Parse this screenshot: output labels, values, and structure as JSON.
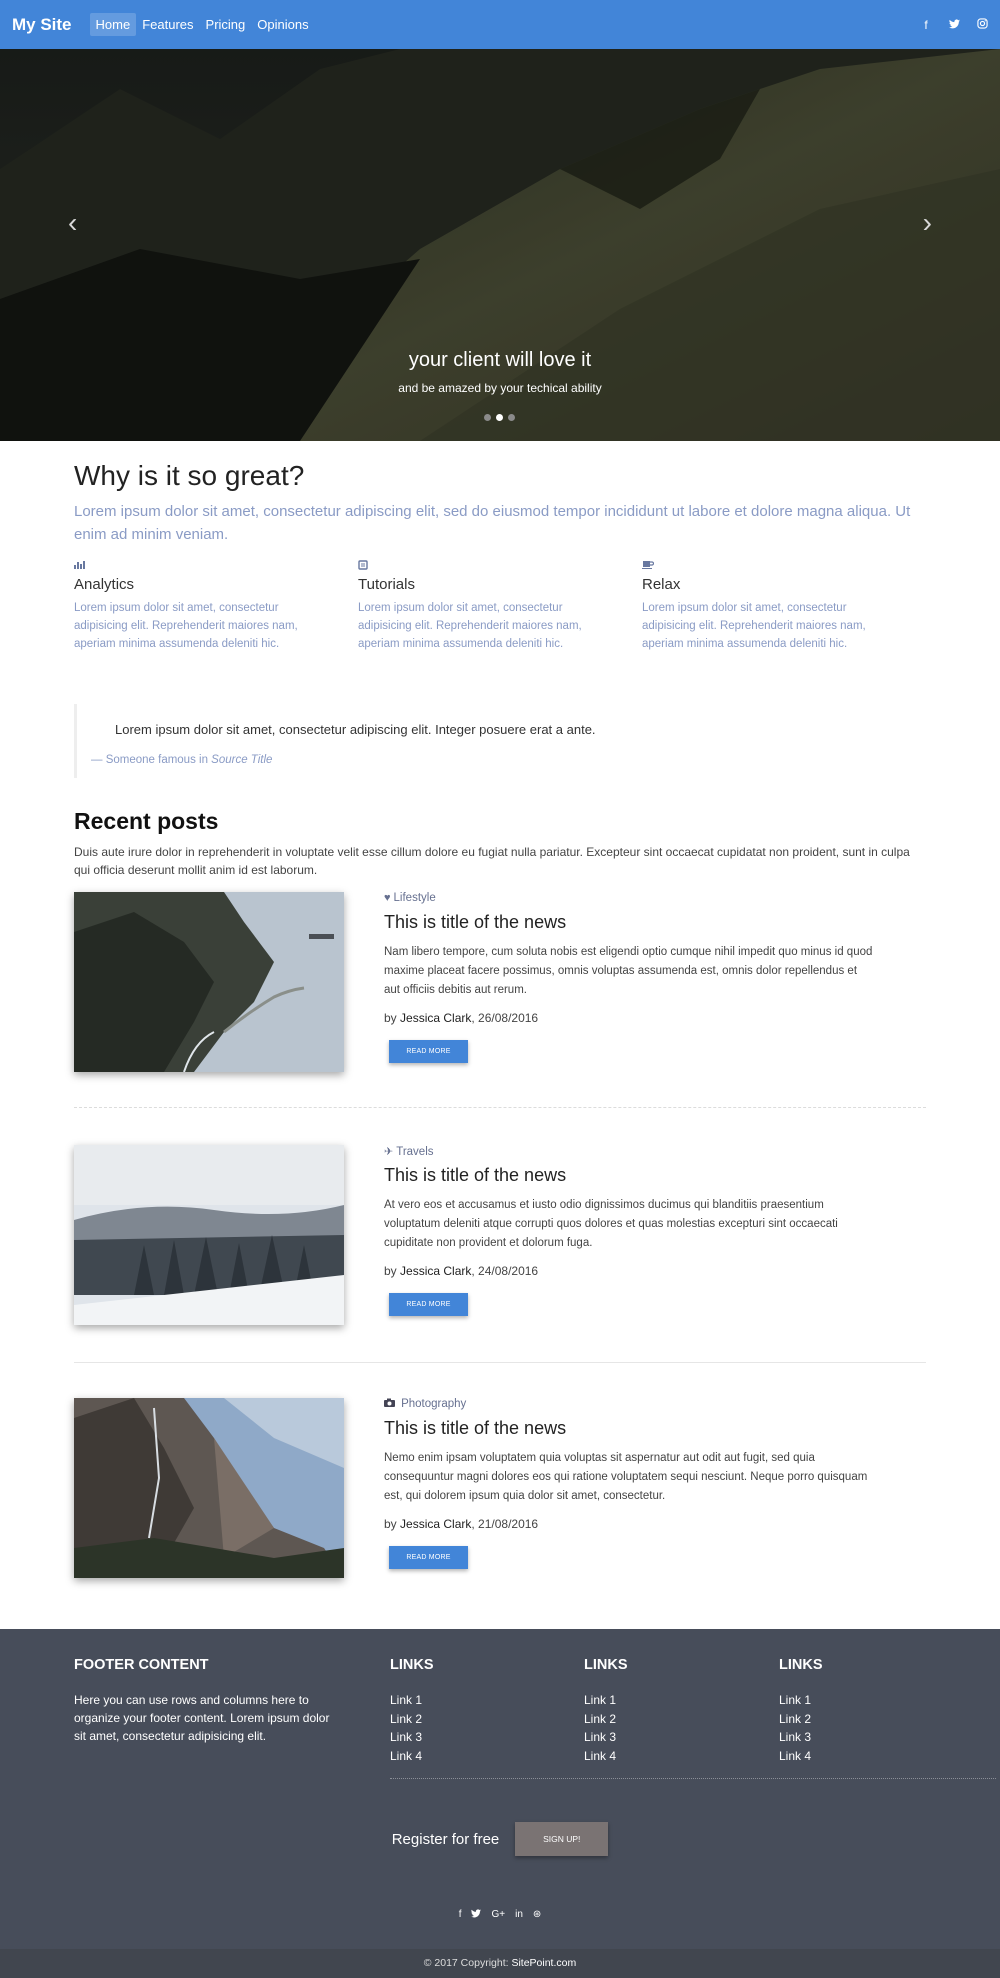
{
  "nav": {
    "brand": "My Site",
    "links": [
      "Home",
      "Features",
      "Pricing",
      "Opinions"
    ],
    "social_icons": [
      "facebook-icon",
      "twitter-icon",
      "instagram-icon"
    ]
  },
  "carousel": {
    "title": "your client will love it",
    "subtitle": "and be amazed by your techical ability",
    "slides_count": 3,
    "active_slide": 2
  },
  "why": {
    "title": "Why is it so great?",
    "lead": "Lorem ipsum dolor sit amet, consectetur adipiscing elit, sed do eiusmod tempor incididunt ut labore et dolore magna aliqua. Ut enim ad minim veniam.",
    "features": [
      {
        "icon": "analytics-icon",
        "title": "Analytics",
        "text": "Lorem ipsum dolor sit amet, consectetur adipisicing elit. Reprehenderit maiores nam, aperiam minima assumenda deleniti hic."
      },
      {
        "icon": "book-icon",
        "title": "Tutorials",
        "text": "Lorem ipsum dolor sit amet, consectetur adipisicing elit. Reprehenderit maiores nam, aperiam minima assumenda deleniti hic."
      },
      {
        "icon": "coffee-icon",
        "title": "Relax",
        "text": "Lorem ipsum dolor sit amet, consectetur adipisicing elit. Reprehenderit maiores nam, aperiam minima assumenda deleniti hic."
      }
    ]
  },
  "quote": {
    "text": "Lorem ipsum dolor sit amet, consectetur adipiscing elit. Integer posuere erat a ante.",
    "author": "— Someone famous in ",
    "source": "Source Title"
  },
  "posts": {
    "title": "Recent posts",
    "intro": "Duis aute irure dolor in reprehenderit in voluptate velit esse cillum dolore eu fugiat nulla pariatur. Excepteur sint occaecat cupidatat non proident, sunt in culpa qui officia deserunt mollit anim id est laborum.",
    "items": [
      {
        "category_icon": "heart-icon",
        "category": "Lifestyle",
        "title": "This is title of the news",
        "excerpt": "Nam libero tempore, cum soluta nobis est eligendi optio cumque nihil impedit quo minus id quod maxime placeat facere possimus, omnis voluptas assumenda est, omnis dolor repellendus et aut officiis debitis aut rerum.",
        "by": "by ",
        "author": "Jessica Clark",
        "date": ", 26/08/2016",
        "button": "READ MORE"
      },
      {
        "category_icon": "plane-icon",
        "category": "Travels",
        "title": "This is title of the news",
        "excerpt": "At vero eos et accusamus et iusto odio dignissimos ducimus qui blanditiis praesentium voluptatum deleniti atque corrupti quos dolores et quas molestias excepturi sint occaecati cupiditate non provident et dolorum fuga.",
        "by": "by ",
        "author": "Jessica Clark",
        "date": ", 24/08/2016",
        "button": "READ MORE"
      },
      {
        "category_icon": "camera-icon",
        "category": "Photography",
        "title": "This is title of the news",
        "excerpt": "Nemo enim ipsam voluptatem quia voluptas sit aspernatur aut odit aut fugit, sed quia consequuntur magni dolores eos qui ratione voluptatem sequi nesciunt. Neque porro quisquam est, qui dolorem ipsum quia dolor sit amet, consectetur.",
        "by": "by ",
        "author": "Jessica Clark",
        "date": ", 21/08/2016",
        "button": "READ MORE"
      }
    ]
  },
  "footer": {
    "content_title": "FOOTER CONTENT",
    "content_text": "Here you can use rows and columns here to organize your footer content. Lorem ipsum dolor sit amet, consectetur adipisicing elit.",
    "link_columns": [
      {
        "title": "LINKS",
        "links": [
          "Link 1",
          "Link 2",
          "Link 3",
          "Link 4"
        ]
      },
      {
        "title": "LINKS",
        "links": [
          "Link 1",
          "Link 2",
          "Link 3",
          "Link 4"
        ]
      },
      {
        "title": "LINKS",
        "links": [
          "Link 1",
          "Link 2",
          "Link 3",
          "Link 4"
        ]
      }
    ],
    "register_text": "Register for free",
    "signup_button": "SIGN UP!",
    "social_icons": [
      "facebook-icon",
      "twitter-icon",
      "google-plus-icon",
      "linkedin-icon",
      "dribbble-icon"
    ],
    "copyright_prefix": "© 2017 Copyright: ",
    "copyright_site": "SitePoint.com"
  },
  "colors": {
    "primary": "#4285d8",
    "footer_bg": "#474d5a",
    "muted_text": "#8a9bc5"
  }
}
